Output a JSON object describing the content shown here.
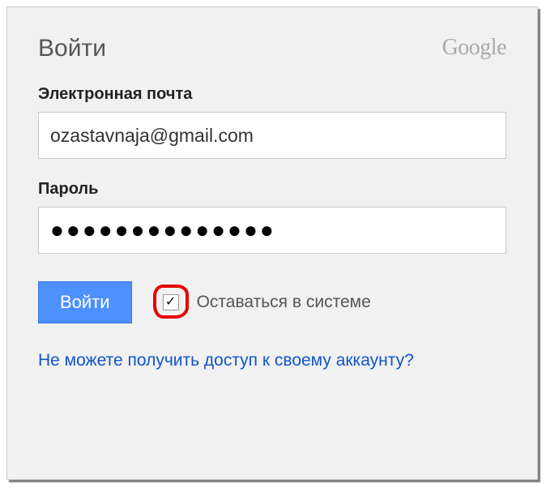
{
  "header": {
    "title": "Войти",
    "brand": "Google"
  },
  "fields": {
    "email": {
      "label": "Электронная почта",
      "value": "ozastavnaja@gmail.com"
    },
    "password": {
      "label": "Пароль",
      "value": "●●●●●●●●●●●●●●"
    }
  },
  "actions": {
    "signin_label": "Войти",
    "stay_signed_in_label": "Оставаться в системе",
    "stay_signed_in_checked": true
  },
  "help": {
    "cant_access_label": "Не можете получить доступ к своему аккаунту?"
  }
}
